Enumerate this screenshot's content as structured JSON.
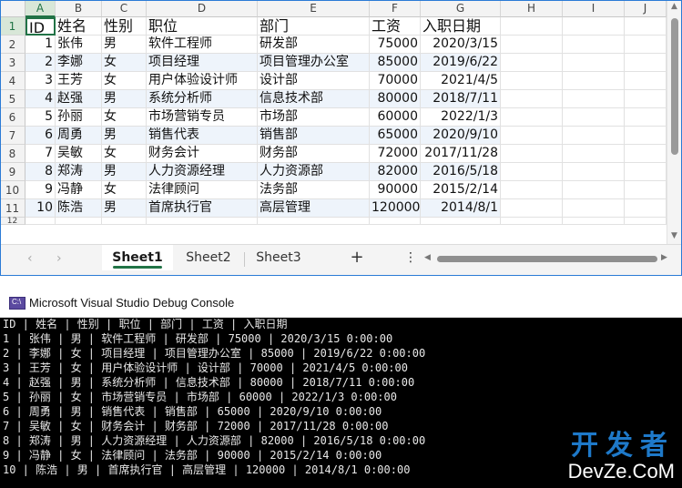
{
  "excel": {
    "columns": [
      "A",
      "B",
      "C",
      "D",
      "E",
      "F",
      "G",
      "H",
      "I",
      "J"
    ],
    "rows": [
      "1",
      "2",
      "3",
      "4",
      "5",
      "6",
      "7",
      "8",
      "9",
      "10",
      "11",
      "12"
    ],
    "header": [
      "ID",
      "姓名",
      "性别",
      "职位",
      "部门",
      "工资",
      "入职日期"
    ],
    "data": [
      [
        "1",
        "张伟",
        "男",
        "软件工程师",
        "研发部",
        "75000",
        "2020/3/15"
      ],
      [
        "2",
        "李娜",
        "女",
        "项目经理",
        "项目管理办公室",
        "85000",
        "2019/6/22"
      ],
      [
        "3",
        "王芳",
        "女",
        "用户体验设计师",
        "设计部",
        "70000",
        "2021/4/5"
      ],
      [
        "4",
        "赵强",
        "男",
        "系统分析师",
        "信息技术部",
        "80000",
        "2018/7/11"
      ],
      [
        "5",
        "孙丽",
        "女",
        "市场营销专员",
        "市场部",
        "60000",
        "2022/1/3"
      ],
      [
        "6",
        "周勇",
        "男",
        "销售代表",
        "销售部",
        "65000",
        "2020/9/10"
      ],
      [
        "7",
        "吴敏",
        "女",
        "财务会计",
        "财务部",
        "72000",
        "2017/11/28"
      ],
      [
        "8",
        "郑涛",
        "男",
        "人力资源经理",
        "人力资源部",
        "82000",
        "2016/5/18"
      ],
      [
        "9",
        "冯静",
        "女",
        "法律顾问",
        "法务部",
        "90000",
        "2015/2/14"
      ],
      [
        "10",
        "陈浩",
        "男",
        "首席执行官",
        "高层管理",
        "120000",
        "2014/8/1"
      ]
    ],
    "tabs": [
      "Sheet1",
      "Sheet2",
      "Sheet3"
    ],
    "add_tab": "+",
    "more_icon": "⋮",
    "prev_icon": "‹",
    "next_icon": "›",
    "scroll_up_icon": "▲",
    "scroll_down_icon": "▼",
    "scroll_left_icon": "◀",
    "scroll_right_icon": "▶",
    "accent_color": "#217346",
    "band_color": "#eef4fb"
  },
  "console": {
    "title": "Microsoft Visual Studio Debug Console",
    "icon_text": "C:\\",
    "lines": [
      "ID | 姓名 | 性别 | 职位 | 部门 | 工资 | 入职日期",
      "1 | 张伟 | 男 | 软件工程师 | 研发部 | 75000 | 2020/3/15 0:00:00",
      "2 | 李娜 | 女 | 项目经理 | 项目管理办公室 | 85000 | 2019/6/22 0:00:00",
      "3 | 王芳 | 女 | 用户体验设计师 | 设计部 | 70000 | 2021/4/5 0:00:00",
      "4 | 赵强 | 男 | 系统分析师 | 信息技术部 | 80000 | 2018/7/11 0:00:00",
      "5 | 孙丽 | 女 | 市场营销专员 | 市场部 | 60000 | 2022/1/3 0:00:00",
      "6 | 周勇 | 男 | 销售代表 | 销售部 | 65000 | 2020/9/10 0:00:00",
      "7 | 吴敏 | 女 | 财务会计 | 财务部 | 72000 | 2017/11/28 0:00:00",
      "8 | 郑涛 | 男 | 人力资源经理 | 人力资源部 | 82000 | 2016/5/18 0:00:00",
      "9 | 冯静 | 女 | 法律顾问 | 法务部 | 90000 | 2015/2/14 0:00:00",
      "10 | 陈浩 | 男 | 首席执行官 | 高层管理 | 120000 | 2014/8/1 0:00:00"
    ]
  },
  "watermark": {
    "cn": "开发者",
    "en": "DevZe.CoM"
  }
}
